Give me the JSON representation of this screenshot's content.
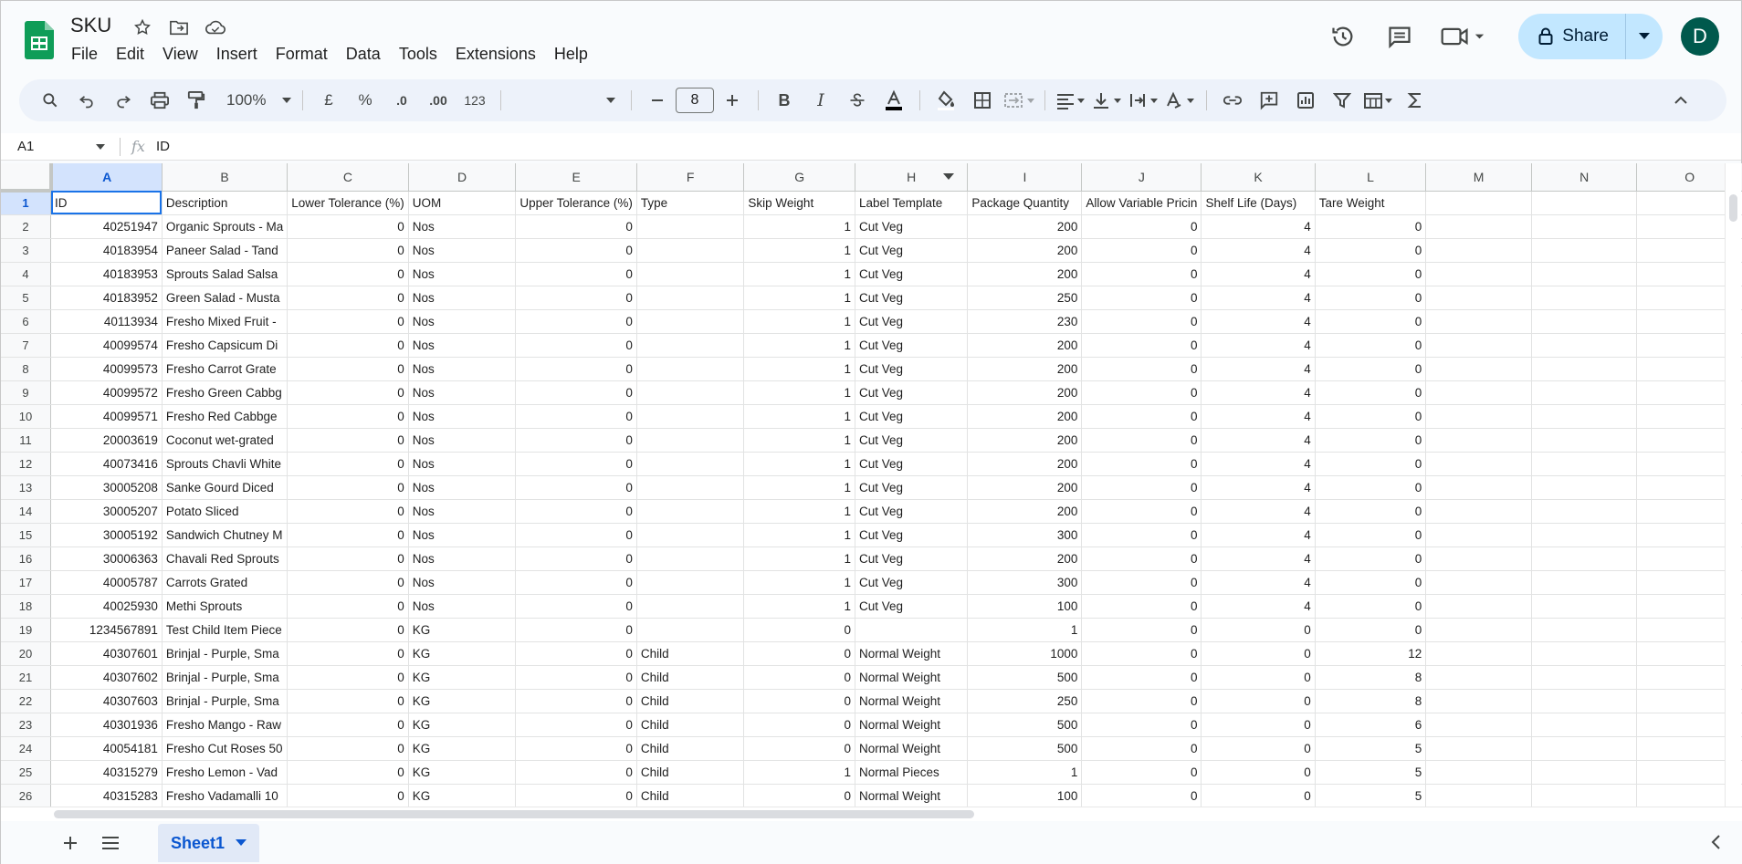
{
  "app": {
    "title": "SKU",
    "brand_color": "#0f9d58"
  },
  "menu": [
    "File",
    "Edit",
    "View",
    "Insert",
    "Format",
    "Data",
    "Tools",
    "Extensions",
    "Help"
  ],
  "share": {
    "label": "Share",
    "avatar_initial": "D"
  },
  "toolbar": {
    "zoom": "100%",
    "currency": "£",
    "percent": "%",
    "decrease_decimal": ".0",
    "increase_decimal": ".00",
    "number_format": "123",
    "font_size": "8",
    "bold": "B",
    "italic": "I"
  },
  "formula_bar": {
    "cell_ref": "A1",
    "fx": "fx",
    "content": "ID"
  },
  "columns": [
    "A",
    "B",
    "C",
    "D",
    "E",
    "F",
    "G",
    "H",
    "I",
    "J",
    "K",
    "L",
    "M",
    "N",
    "O"
  ],
  "header_row": [
    "ID",
    "Description",
    "Lower Tolerance (%)",
    "UOM",
    "Upper Tolerance (%)",
    "Type",
    "Skip Weight",
    "Label Template",
    "Package Quantity",
    "Allow Variable Pricin",
    "Shelf Life (Days)",
    "Tare Weight",
    "",
    "",
    ""
  ],
  "rows": [
    [
      "40251947",
      "Organic Sprouts - Ma",
      "0",
      "Nos",
      "0",
      "",
      "1",
      "Cut Veg",
      "200",
      "0",
      "4",
      "0"
    ],
    [
      "40183954",
      "Paneer Salad - Tand",
      "0",
      "Nos",
      "0",
      "",
      "1",
      "Cut Veg",
      "200",
      "0",
      "4",
      "0"
    ],
    [
      "40183953",
      "Sprouts Salad Salsa",
      "0",
      "Nos",
      "0",
      "",
      "1",
      "Cut Veg",
      "200",
      "0",
      "4",
      "0"
    ],
    [
      "40183952",
      "Green Salad - Musta",
      "0",
      "Nos",
      "0",
      "",
      "1",
      "Cut Veg",
      "250",
      "0",
      "4",
      "0"
    ],
    [
      "40113934",
      "Fresho Mixed Fruit -",
      "0",
      "Nos",
      "0",
      "",
      "1",
      "Cut Veg",
      "230",
      "0",
      "4",
      "0"
    ],
    [
      "40099574",
      "Fresho Capsicum Di",
      "0",
      "Nos",
      "0",
      "",
      "1",
      "Cut Veg",
      "200",
      "0",
      "4",
      "0"
    ],
    [
      "40099573",
      "Fresho Carrot Grate",
      "0",
      "Nos",
      "0",
      "",
      "1",
      "Cut Veg",
      "200",
      "0",
      "4",
      "0"
    ],
    [
      "40099572",
      "Fresho Green Cabbg",
      "0",
      "Nos",
      "0",
      "",
      "1",
      "Cut Veg",
      "200",
      "0",
      "4",
      "0"
    ],
    [
      "40099571",
      "Fresho Red Cabbge",
      "0",
      "Nos",
      "0",
      "",
      "1",
      "Cut Veg",
      "200",
      "0",
      "4",
      "0"
    ],
    [
      "20003619",
      "Coconut wet-grated",
      "0",
      "Nos",
      "0",
      "",
      "1",
      "Cut Veg",
      "200",
      "0",
      "4",
      "0"
    ],
    [
      "40073416",
      "Sprouts Chavli White",
      "0",
      "Nos",
      "0",
      "",
      "1",
      "Cut Veg",
      "200",
      "0",
      "4",
      "0"
    ],
    [
      "30005208",
      "Sanke Gourd Diced",
      "0",
      "Nos",
      "0",
      "",
      "1",
      "Cut Veg",
      "200",
      "0",
      "4",
      "0"
    ],
    [
      "30005207",
      "Potato Sliced",
      "0",
      "Nos",
      "0",
      "",
      "1",
      "Cut Veg",
      "200",
      "0",
      "4",
      "0"
    ],
    [
      "30005192",
      "Sandwich Chutney M",
      "0",
      "Nos",
      "0",
      "",
      "1",
      "Cut Veg",
      "300",
      "0",
      "4",
      "0"
    ],
    [
      "30006363",
      "Chavali Red Sprouts",
      "0",
      "Nos",
      "0",
      "",
      "1",
      "Cut Veg",
      "200",
      "0",
      "4",
      "0"
    ],
    [
      "40005787",
      "Carrots Grated",
      "0",
      "Nos",
      "0",
      "",
      "1",
      "Cut Veg",
      "300",
      "0",
      "4",
      "0"
    ],
    [
      "40025930",
      "Methi Sprouts",
      "0",
      "Nos",
      "0",
      "",
      "1",
      "Cut Veg",
      "100",
      "0",
      "4",
      "0"
    ],
    [
      "1234567891",
      "Test Child Item Piece",
      "0",
      "KG",
      "0",
      "",
      "0",
      "",
      "1",
      "0",
      "0",
      "0"
    ],
    [
      "40307601",
      "Brinjal - Purple, Sma",
      "0",
      "KG",
      "0",
      "Child",
      "0",
      "Normal Weight",
      "1000",
      "0",
      "0",
      "12"
    ],
    [
      "40307602",
      "Brinjal - Purple, Sma",
      "0",
      "KG",
      "0",
      "Child",
      "0",
      "Normal Weight",
      "500",
      "0",
      "0",
      "8"
    ],
    [
      "40307603",
      "Brinjal - Purple, Sma",
      "0",
      "KG",
      "0",
      "Child",
      "0",
      "Normal Weight",
      "250",
      "0",
      "0",
      "8"
    ],
    [
      "40301936",
      "Fresho Mango - Raw",
      "0",
      "KG",
      "0",
      "Child",
      "0",
      "Normal Weight",
      "500",
      "0",
      "0",
      "6"
    ],
    [
      "40054181",
      "Fresho Cut Roses 50",
      "0",
      "KG",
      "0",
      "Child",
      "0",
      "Normal Weight",
      "500",
      "0",
      "0",
      "5"
    ],
    [
      "40315279",
      "Fresho Lemon - Vad",
      "0",
      "KG",
      "0",
      "Child",
      "1",
      "Normal Pieces",
      "1",
      "0",
      "0",
      "5"
    ],
    [
      "40315283",
      "Fresho Vadamalli 10",
      "0",
      "KG",
      "0",
      "Child",
      "0",
      "Normal Weight",
      "100",
      "0",
      "0",
      "5"
    ]
  ],
  "sheets": [
    {
      "name": "Sheet1",
      "active": true
    }
  ]
}
